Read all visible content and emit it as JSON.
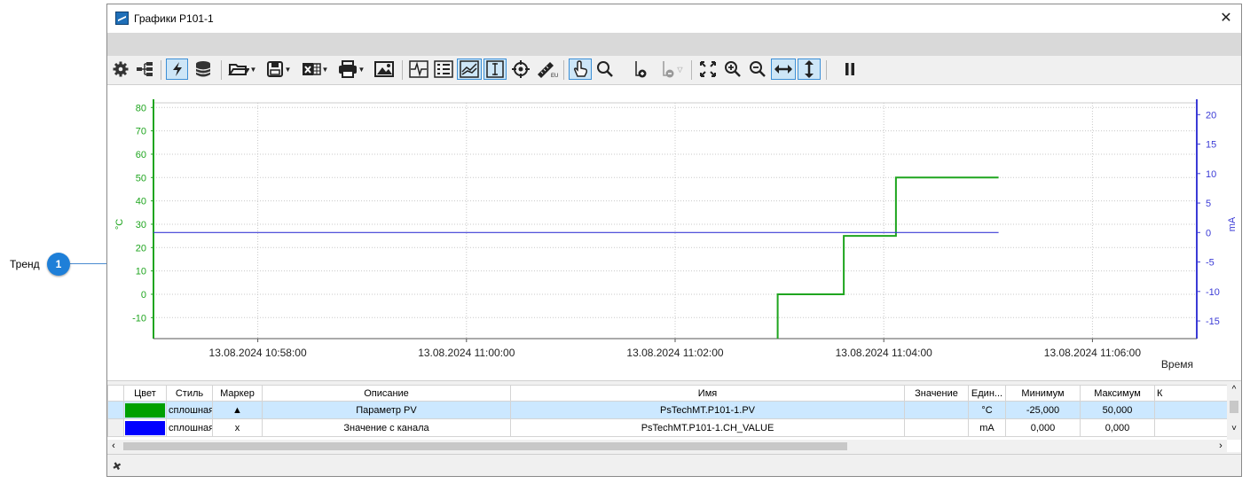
{
  "callout": {
    "label": "Тренд",
    "number": "1"
  },
  "window": {
    "title": "Графики P101-1",
    "close": "✕"
  },
  "toolbar": {
    "items": [
      "settings-icon",
      "tree-icon",
      "lightning-icon",
      "database-icon",
      "open-folder-icon",
      "save-icon",
      "excel-icon",
      "print-icon",
      "image-icon",
      "pulse-icon",
      "legend-icon",
      "trend-icon",
      "vertical-cursor-icon",
      "crosshair-icon",
      "ruler-eu-icon",
      "hand-pointer-icon",
      "magnifier-icon",
      "add-marker-icon",
      "remove-marker-icon",
      "fit-icon",
      "zoom-in-icon",
      "zoom-out-icon",
      "horizontal-scale-icon",
      "vertical-scale-icon",
      "pause-icon"
    ]
  },
  "chart_data": {
    "type": "line",
    "xlabel": "Время",
    "y_left_label": "°C",
    "y_right_label": "mA",
    "y_left_range": [
      -19,
      82
    ],
    "y_right_range": [
      -18,
      22
    ],
    "y_left_ticks": [
      "80",
      "70",
      "60",
      "50",
      "40",
      "30",
      "20",
      "10",
      "0",
      "-10"
    ],
    "y_right_ticks": [
      "20",
      "15",
      "10",
      "5",
      "0",
      "-5",
      "-10",
      "-15"
    ],
    "x_ticks": [
      "13.08.2024 10:58:00",
      "13.08.2024 11:00:00",
      "13.08.2024 11:02:00",
      "13.08.2024 11:04:00",
      "13.08.2024 11:06:00"
    ],
    "series": [
      {
        "name": "Параметр PV",
        "axis": "left",
        "color": "#1fa51f",
        "style": "step",
        "x": [
          "11:02:59",
          "11:02:59",
          "11:03:37",
          "11:03:37",
          "11:04:07",
          "11:04:07",
          "11:05:06"
        ],
        "y": [
          -19,
          0,
          0,
          25,
          25,
          50,
          50
        ]
      },
      {
        "name": "Значение с канала",
        "axis": "right",
        "color": "#3b3bd6",
        "style": "line",
        "x": [
          "10:57:00",
          "11:05:06"
        ],
        "y": [
          0,
          0
        ]
      }
    ],
    "grid": true
  },
  "table": {
    "headers": [
      "Цвет",
      "Стиль",
      "Маркер",
      "Описание",
      "Имя",
      "Значение",
      "Един...",
      "Минимум",
      "Максимум",
      "К"
    ],
    "rows": [
      {
        "color": "#00a000",
        "style": "сплошная",
        "marker": "▲",
        "description": "Параметр PV",
        "name": "PsTechMT.P101-1.PV",
        "value": "",
        "unit": "°C",
        "min": "-25,000",
        "max": "50,000",
        "k": ""
      },
      {
        "color": "#0000ff",
        "style": "сплошная",
        "marker": "x",
        "description": "Значение с канала",
        "name": "PsTechMT.P101-1.CH_VALUE",
        "value": "",
        "unit": "mA",
        "min": "0,000",
        "max": "0,000",
        "k": ""
      }
    ]
  },
  "colors": {
    "accent": "#1e7fd8",
    "left_axis": "#1fa51f",
    "right_axis": "#3b3bd6"
  }
}
